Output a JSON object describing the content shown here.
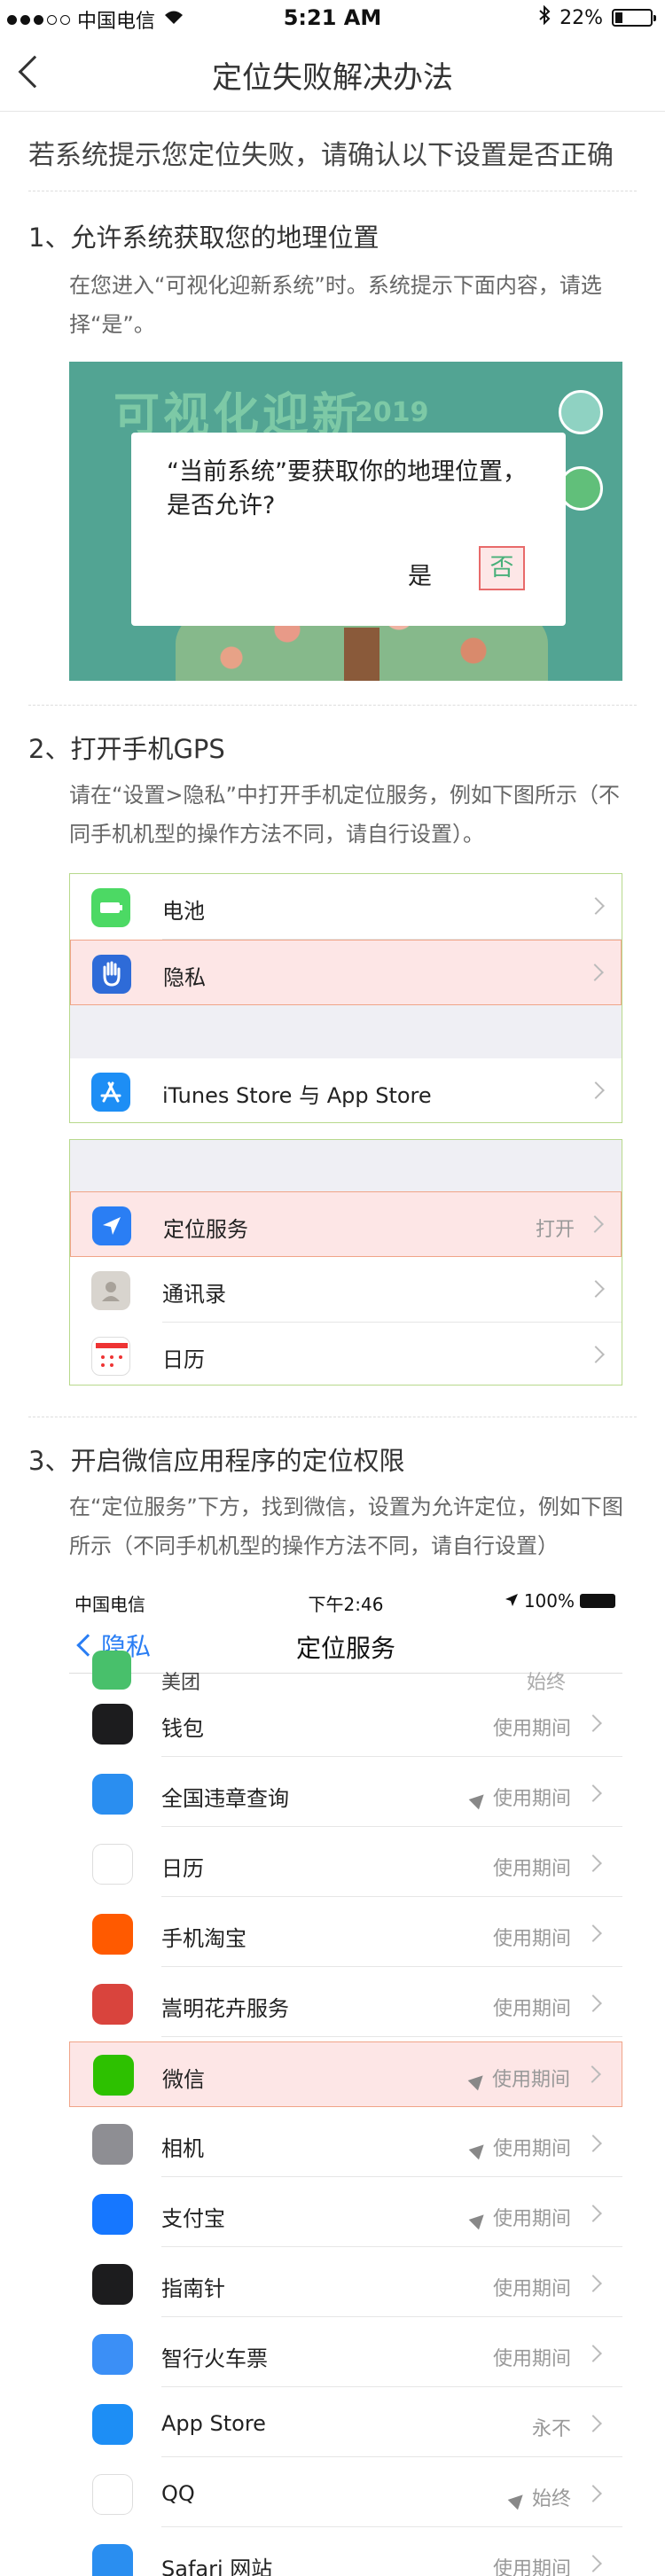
{
  "status_bar": {
    "carrier": "中国电信",
    "time": "5:21 AM",
    "battery": "22%"
  },
  "nav": {
    "title": "定位失败解决办法"
  },
  "intro": "若系统提示您定位失败，请确认以下设置是否正确",
  "section1": {
    "title": "1、允许系统获取您的地理位置",
    "desc": "在您进入“可视化迎新系统”时。系统提示下面内容，请选择“是”。",
    "image": {
      "brand": "可视化迎新",
      "year": "2019"
    },
    "dialog": {
      "message": "“当前系统”要获取你的地理位置，是否允许?",
      "yes": "是",
      "no": "否"
    }
  },
  "section2": {
    "title": "2、打开手机GPS",
    "desc": "请在“设置>隐私”中打开手机定位服务，例如下图所示（不同手机机型的操作方法不同，请自行设置）。",
    "group1": [
      {
        "label": "电池",
        "icon": "battery-icon",
        "color": "#4cd964"
      },
      {
        "label": "隐私",
        "icon": "hand-icon",
        "color": "#2e6bd8",
        "highlight": true
      },
      {
        "label": "iTunes Store 与 App Store",
        "icon": "appstore-icon",
        "color": "#1d8ef5"
      }
    ],
    "group2": [
      {
        "label": "定位服务",
        "value": "打开",
        "icon": "location-arrow-icon",
        "color": "#2a7ef4",
        "highlight": true
      },
      {
        "label": "通讯录",
        "icon": "contacts-icon",
        "color": "#c8c3bc"
      },
      {
        "label": "日历",
        "icon": "calendar-icon",
        "color": "#ffffff"
      }
    ]
  },
  "section3": {
    "title": "3、开启微信应用程序的定位权限",
    "desc": "在“定位服务”下方，找到微信，设置为允许定位，例如下图所示（不同手机机型的操作方法不同，请自行设置）",
    "phone": {
      "carrier": "中国电信",
      "time": "下午2:46",
      "battery": "100%",
      "back": "隐私",
      "title": "定位服务",
      "partial_row": {
        "label": "美团",
        "value": "始终"
      },
      "rows": [
        {
          "label": "钱包",
          "value": "使用期间",
          "icon": "wallet-icon",
          "color": "#1c1c1e",
          "arrow": false
        },
        {
          "label": "全国违章查询",
          "value": "使用期间",
          "icon": "traffic-icon",
          "color": "#2a8ef0",
          "arrow": true
        },
        {
          "label": "日历",
          "value": "使用期间",
          "icon": "calendar-icon",
          "color": "#ffffff",
          "arrow": false
        },
        {
          "label": "手机淘宝",
          "value": "使用期间",
          "icon": "taobao-icon",
          "color": "#ff5a00",
          "arrow": false
        },
        {
          "label": "嵩明花卉服务",
          "value": "使用期间",
          "icon": "flower-icon",
          "color": "#d9443d",
          "arrow": false
        },
        {
          "label": "微信",
          "value": "使用期间",
          "icon": "wechat-icon",
          "color": "#2dc100",
          "arrow": true,
          "highlight": true
        },
        {
          "label": "相机",
          "value": "使用期间",
          "icon": "camera-icon",
          "color": "#8e8e93",
          "arrow": true
        },
        {
          "label": "支付宝",
          "value": "使用期间",
          "icon": "alipay-icon",
          "color": "#1677ff",
          "arrow": true
        },
        {
          "label": "指南针",
          "value": "使用期间",
          "icon": "compass-icon",
          "color": "#1c1c1e",
          "arrow": false
        },
        {
          "label": "智行火车票",
          "value": "使用期间",
          "icon": "train-icon",
          "color": "#3b8ff6",
          "arrow": false
        },
        {
          "label": "App Store",
          "value": "永不",
          "icon": "appstore-icon",
          "color": "#1d8ef5",
          "arrow": false
        },
        {
          "label": "QQ",
          "value": "始终",
          "icon": "qq-icon",
          "color": "#ffffff",
          "arrow": true
        },
        {
          "label": "Safari 网站",
          "value": "使用期间",
          "icon": "safari-icon",
          "color": "#2a8ef0",
          "arrow": false
        }
      ]
    }
  }
}
